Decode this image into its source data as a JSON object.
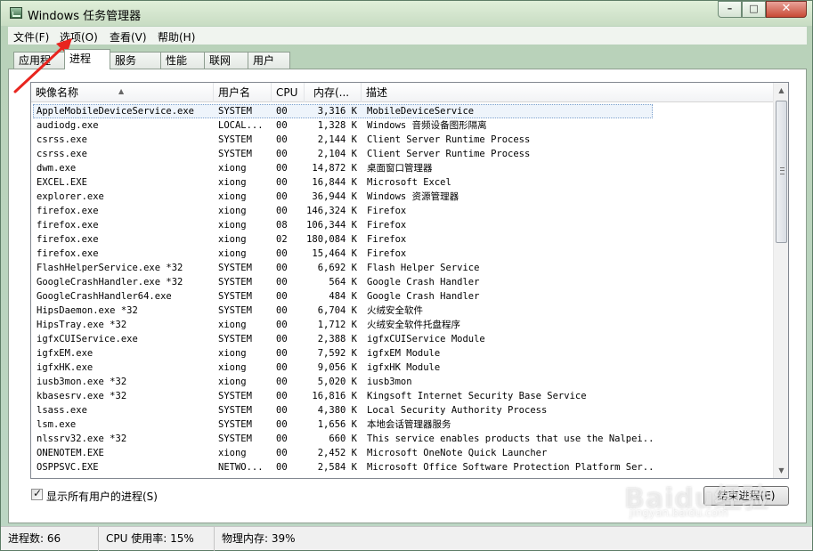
{
  "window": {
    "title": "Windows 任务管理器",
    "controls": {
      "minimize": "–",
      "maximize": "□",
      "close": "✕"
    }
  },
  "menu": [
    "文件(F)",
    "选项(O)",
    "查看(V)",
    "帮助(H)"
  ],
  "tabs": [
    "应用程序",
    "进程",
    "服务",
    "性能",
    "联网",
    "用户"
  ],
  "active_tab": "进程",
  "columns": {
    "name": "映像名称",
    "user": "用户名",
    "cpu": "CPU",
    "mem": "内存(...",
    "desc": "描述"
  },
  "sort_indicator": "▲",
  "processes": [
    {
      "name": "AppleMobileDeviceService.exe",
      "user": "SYSTEM",
      "cpu": "00",
      "mem": "3,316 K",
      "desc": "MobileDeviceService"
    },
    {
      "name": "audiodg.exe",
      "user": "LOCAL...",
      "cpu": "00",
      "mem": "1,328 K",
      "desc": "Windows 音频设备图形隔离"
    },
    {
      "name": "csrss.exe",
      "user": "SYSTEM",
      "cpu": "00",
      "mem": "2,144 K",
      "desc": "Client Server Runtime Process"
    },
    {
      "name": "csrss.exe",
      "user": "SYSTEM",
      "cpu": "00",
      "mem": "2,104 K",
      "desc": "Client Server Runtime Process"
    },
    {
      "name": "dwm.exe",
      "user": "xiong",
      "cpu": "00",
      "mem": "14,872 K",
      "desc": "桌面窗口管理器"
    },
    {
      "name": "EXCEL.EXE",
      "user": "xiong",
      "cpu": "00",
      "mem": "16,844 K",
      "desc": "Microsoft Excel"
    },
    {
      "name": "explorer.exe",
      "user": "xiong",
      "cpu": "00",
      "mem": "36,944 K",
      "desc": "Windows 资源管理器"
    },
    {
      "name": "firefox.exe",
      "user": "xiong",
      "cpu": "00",
      "mem": "146,324 K",
      "desc": "Firefox"
    },
    {
      "name": "firefox.exe",
      "user": "xiong",
      "cpu": "08",
      "mem": "106,344 K",
      "desc": "Firefox"
    },
    {
      "name": "firefox.exe",
      "user": "xiong",
      "cpu": "02",
      "mem": "180,084 K",
      "desc": "Firefox"
    },
    {
      "name": "firefox.exe",
      "user": "xiong",
      "cpu": "00",
      "mem": "15,464 K",
      "desc": "Firefox"
    },
    {
      "name": "FlashHelperService.exe *32",
      "user": "SYSTEM",
      "cpu": "00",
      "mem": "6,692 K",
      "desc": "Flash Helper Service"
    },
    {
      "name": "GoogleCrashHandler.exe *32",
      "user": "SYSTEM",
      "cpu": "00",
      "mem": "564 K",
      "desc": "Google Crash Handler"
    },
    {
      "name": "GoogleCrashHandler64.exe",
      "user": "SYSTEM",
      "cpu": "00",
      "mem": "484 K",
      "desc": "Google Crash Handler"
    },
    {
      "name": "HipsDaemon.exe *32",
      "user": "SYSTEM",
      "cpu": "00",
      "mem": "6,704 K",
      "desc": "火绒安全软件"
    },
    {
      "name": "HipsTray.exe *32",
      "user": "xiong",
      "cpu": "00",
      "mem": "1,712 K",
      "desc": "火绒安全软件托盘程序"
    },
    {
      "name": "igfxCUIService.exe",
      "user": "SYSTEM",
      "cpu": "00",
      "mem": "2,388 K",
      "desc": "igfxCUIService Module"
    },
    {
      "name": "igfxEM.exe",
      "user": "xiong",
      "cpu": "00",
      "mem": "7,592 K",
      "desc": "igfxEM Module"
    },
    {
      "name": "igfxHK.exe",
      "user": "xiong",
      "cpu": "00",
      "mem": "9,056 K",
      "desc": "igfxHK Module"
    },
    {
      "name": "iusb3mon.exe *32",
      "user": "xiong",
      "cpu": "00",
      "mem": "5,020 K",
      "desc": "iusb3mon"
    },
    {
      "name": "kbasesrv.exe *32",
      "user": "SYSTEM",
      "cpu": "00",
      "mem": "16,816 K",
      "desc": "Kingsoft Internet Security Base Service"
    },
    {
      "name": "lsass.exe",
      "user": "SYSTEM",
      "cpu": "00",
      "mem": "4,380 K",
      "desc": "Local Security Authority Process"
    },
    {
      "name": "lsm.exe",
      "user": "SYSTEM",
      "cpu": "00",
      "mem": "1,656 K",
      "desc": "本地会话管理器服务"
    },
    {
      "name": "nlssrv32.exe *32",
      "user": "SYSTEM",
      "cpu": "00",
      "mem": "660 K",
      "desc": "This service enables products that use the Nalpei..."
    },
    {
      "name": "ONENOTEM.EXE",
      "user": "xiong",
      "cpu": "00",
      "mem": "2,452 K",
      "desc": "Microsoft OneNote Quick Launcher"
    },
    {
      "name": "OSPPSVC.EXE",
      "user": "NETWO...",
      "cpu": "00",
      "mem": "2,584 K",
      "desc": "Microsoft Office Software Protection Platform Ser..."
    }
  ],
  "selected_index": 0,
  "show_all_users_checkbox": {
    "label": "显示所有用户的进程(S)",
    "checked": true,
    "mark": "✓"
  },
  "end_process_button": "结束进程(E)",
  "status": {
    "processes": "进程数: 66",
    "cpu": "CPU 使用率: 15%",
    "memory": "物理内存: 39%"
  },
  "watermark": {
    "brand": "Baidu经验",
    "url": "jingyan.baidu.com"
  },
  "scrollbar": {
    "up": "▲",
    "down": "▼"
  },
  "accent_colors": {
    "annotation_arrow": "#e8251f",
    "selection": "#7da2ce"
  }
}
